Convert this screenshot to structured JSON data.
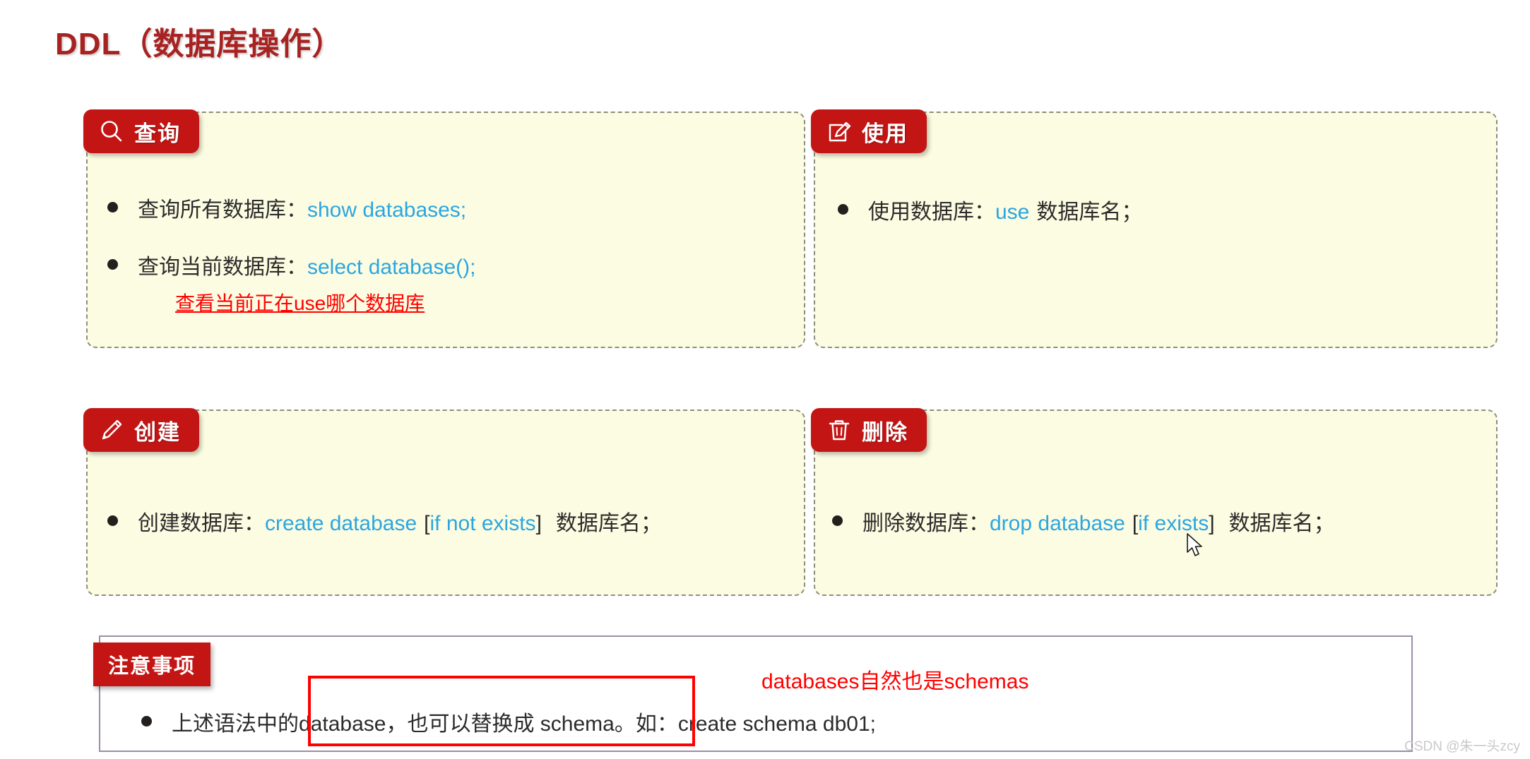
{
  "page": {
    "title": "DDL（数据库操作）",
    "watermark": "CSDN @朱一头zcy"
  },
  "colors": {
    "badge_red": "#c41515",
    "title_red": "#a92222",
    "code_blue": "#2ba6e0",
    "annotation_red": "#ff0000",
    "card_bg": "#fcfce2",
    "card_border": "#8d8d80"
  },
  "cards": [
    {
      "id": "query",
      "badge_label": "查询",
      "badge_icon": "search-icon",
      "rows": [
        {
          "label": "查询所有数据库：",
          "code": "show databases;"
        },
        {
          "label": "查询当前数据库：",
          "code": "select database();"
        }
      ],
      "annotation": "查看当前正在use哪个数据库"
    },
    {
      "id": "use",
      "badge_label": "使用",
      "badge_icon": "edit-square-icon",
      "rows": [
        {
          "label": "使用数据库：",
          "code": "use",
          "tail": "数据库名；"
        }
      ]
    },
    {
      "id": "create",
      "badge_label": "创建",
      "badge_icon": "pencil-icon",
      "rows": [
        {
          "label": "创建数据库：",
          "code": "create  database",
          "bracket_open": "[",
          "optional": "if  not  exists",
          "bracket_close": "]",
          "tail": "数据库名；"
        }
      ]
    },
    {
      "id": "drop",
      "badge_label": "删除",
      "badge_icon": "trash-icon",
      "rows": [
        {
          "label": "删除数据库：",
          "code": "drop  database",
          "bracket_open": "[",
          "optional": "if exists",
          "bracket_close": "]",
          "tail": "数据库名；"
        }
      ]
    }
  ],
  "notice": {
    "badge_label": "注意事项",
    "text_before": "上述语法中",
    "text_highlight": "的database，也可以替换成 schema",
    "text_after": "。如：create schema  db01;",
    "annotation": "databases自然也是schemas"
  }
}
